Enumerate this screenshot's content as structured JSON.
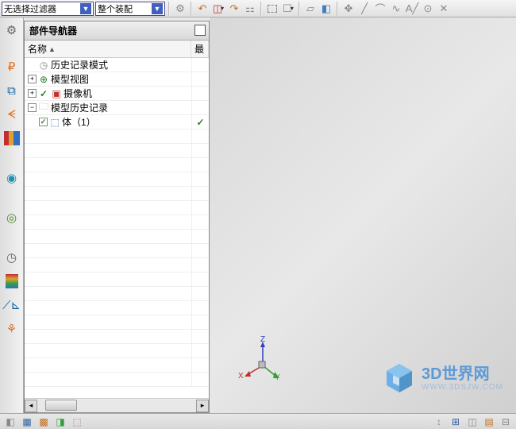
{
  "toolbar": {
    "filter_dropdown": "无选择过滤器",
    "assembly_dropdown": "整个装配"
  },
  "navigator": {
    "title": "部件导航器",
    "columns": {
      "name": "名称",
      "last": "最"
    },
    "items": [
      {
        "label": "历史记录模式",
        "icon": "clock",
        "expand": null,
        "indent": 0
      },
      {
        "label": "模型视图",
        "icon": "clockg",
        "expand": "plus",
        "indent": 0
      },
      {
        "label": "摄像机",
        "icon": "camera",
        "expand": "plus",
        "indent": 0,
        "check": true
      },
      {
        "label": "模型历史记录",
        "icon": "folder",
        "expand": "minus",
        "indent": 0
      },
      {
        "label": "体（1）",
        "icon": "cube",
        "expand": null,
        "indent": 1,
        "checkbox": true,
        "lastcheck": true
      }
    ]
  },
  "triad": {
    "x": "X",
    "y": "Y",
    "z": "Z"
  },
  "watermark": {
    "main": "3D世界网",
    "sub": "WWW.3DSJW.COM"
  }
}
